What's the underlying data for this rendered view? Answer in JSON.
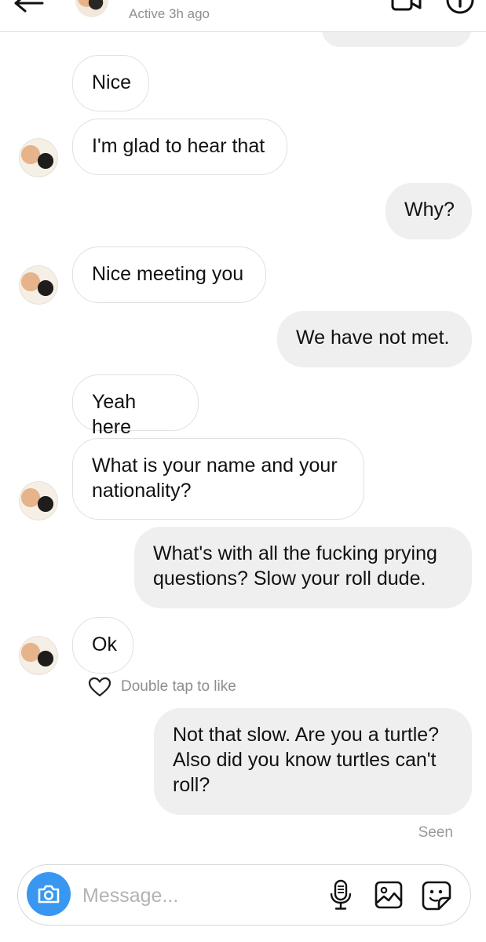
{
  "header": {
    "status": "Active 3h ago"
  },
  "messages": [
    {
      "from": "them",
      "text": "Nice"
    },
    {
      "from": "them",
      "text": "I'm glad to hear that"
    },
    {
      "from": "me",
      "text": "Why?"
    },
    {
      "from": "them",
      "text": "Nice meeting you"
    },
    {
      "from": "me",
      "text": "We have not met."
    },
    {
      "from": "them",
      "text": "Yeah here"
    },
    {
      "from": "them",
      "text": "What is your name and your nationality?"
    },
    {
      "from": "me",
      "text": "What's with all the fucking prying questions? Slow your roll dude."
    },
    {
      "from": "them",
      "text": "Ok"
    },
    {
      "from": "me",
      "text": "Not that slow. Are you a turtle? Also did you know turtles can't roll?"
    }
  ],
  "like_hint": "Double tap to like",
  "seen_label": "Seen",
  "composer": {
    "placeholder": "Message..."
  },
  "icons": [
    "back-arrow-icon",
    "video-call-icon",
    "info-icon",
    "heart-icon",
    "camera-icon",
    "microphone-icon",
    "gallery-icon",
    "sticker-icon"
  ],
  "colors": {
    "accent": "#3897f0",
    "outgoing_bubble": "#efefef",
    "muted_text": "#8e8e8e"
  }
}
